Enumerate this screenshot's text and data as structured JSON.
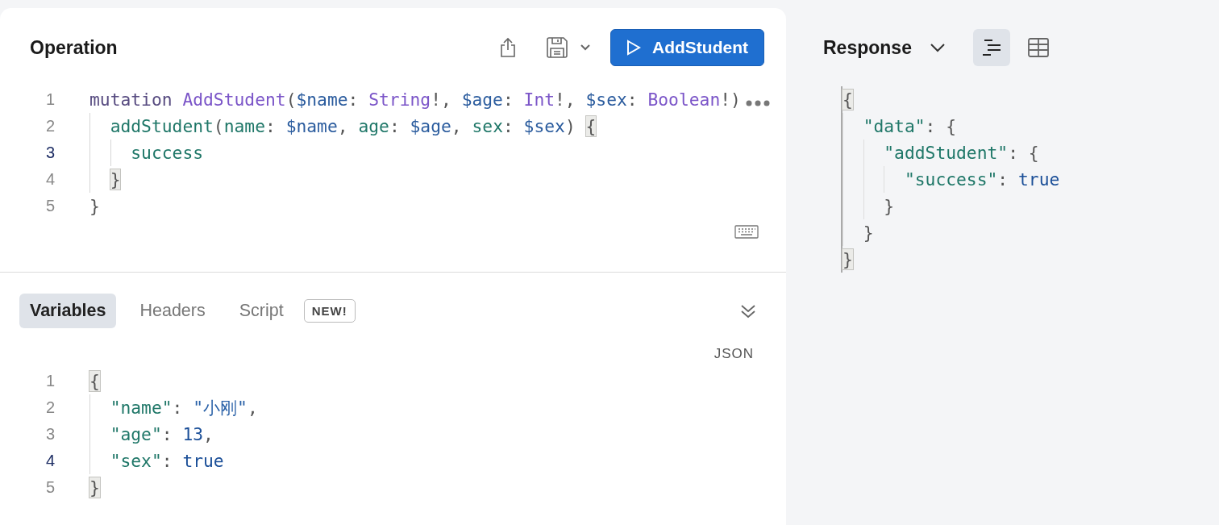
{
  "operation": {
    "title": "Operation",
    "run_button": "AddStudent",
    "lines": [
      {
        "number": "1",
        "current": false,
        "tokens": [
          {
            "kind": "keyword",
            "text": "mutation "
          },
          {
            "kind": "type",
            "text": "AddStudent"
          },
          {
            "kind": "punct",
            "text": "("
          },
          {
            "kind": "variable",
            "text": "$name"
          },
          {
            "kind": "punct",
            "text": ": "
          },
          {
            "kind": "type",
            "text": "String"
          },
          {
            "kind": "punct",
            "text": "!, "
          },
          {
            "kind": "variable",
            "text": "$age"
          },
          {
            "kind": "punct",
            "text": ": "
          },
          {
            "kind": "type",
            "text": "Int"
          },
          {
            "kind": "punct",
            "text": "!, "
          },
          {
            "kind": "variable",
            "text": "$sex"
          },
          {
            "kind": "punct",
            "text": ": "
          },
          {
            "kind": "type",
            "text": "Boolean"
          },
          {
            "kind": "punct",
            "text": "!)"
          }
        ]
      },
      {
        "number": "2",
        "current": false,
        "tokens": [
          {
            "kind": "field",
            "text": "  addStudent"
          },
          {
            "kind": "punct",
            "text": "("
          },
          {
            "kind": "field",
            "text": "name"
          },
          {
            "kind": "punct",
            "text": ": "
          },
          {
            "kind": "variable",
            "text": "$name"
          },
          {
            "kind": "punct",
            "text": ", "
          },
          {
            "kind": "field",
            "text": "age"
          },
          {
            "kind": "punct",
            "text": ": "
          },
          {
            "kind": "variable",
            "text": "$age"
          },
          {
            "kind": "punct",
            "text": ", "
          },
          {
            "kind": "field",
            "text": "sex"
          },
          {
            "kind": "punct",
            "text": ": "
          },
          {
            "kind": "variable",
            "text": "$sex"
          },
          {
            "kind": "punct",
            "text": ") "
          },
          {
            "kind": "match",
            "text": "{"
          }
        ]
      },
      {
        "number": "3",
        "current": true,
        "tokens": [
          {
            "kind": "field",
            "text": "    success"
          }
        ]
      },
      {
        "number": "4",
        "current": false,
        "tokens": [
          {
            "kind": "match",
            "text": "  }"
          }
        ]
      },
      {
        "number": "5",
        "current": false,
        "tokens": [
          {
            "kind": "punct",
            "text": "}"
          }
        ]
      }
    ]
  },
  "variables_panel": {
    "tabs": [
      {
        "label": "Variables",
        "selected": true
      },
      {
        "label": "Headers",
        "selected": false
      },
      {
        "label": "Script",
        "selected": false,
        "badge": "NEW!"
      }
    ],
    "format": "JSON",
    "lines": [
      {
        "number": "1",
        "current": false,
        "tokens": [
          {
            "kind": "match",
            "text": "{"
          }
        ]
      },
      {
        "number": "2",
        "current": false,
        "tokens": [
          {
            "kind": "key",
            "text": "  \"name\""
          },
          {
            "kind": "punct",
            "text": ": "
          },
          {
            "kind": "string",
            "text": "\"小刚\""
          },
          {
            "kind": "punct",
            "text": ","
          }
        ]
      },
      {
        "number": "3",
        "current": false,
        "tokens": [
          {
            "kind": "key",
            "text": "  \"age\""
          },
          {
            "kind": "punct",
            "text": ": "
          },
          {
            "kind": "number",
            "text": "13"
          },
          {
            "kind": "punct",
            "text": ","
          }
        ]
      },
      {
        "number": "4",
        "current": true,
        "tokens": [
          {
            "kind": "key",
            "text": "  \"sex\""
          },
          {
            "kind": "punct",
            "text": ": "
          },
          {
            "kind": "number",
            "text": "true"
          }
        ]
      },
      {
        "number": "5",
        "current": false,
        "tokens": [
          {
            "kind": "match",
            "text": "}"
          }
        ]
      }
    ]
  },
  "response": {
    "title": "Response",
    "views": [
      {
        "kind": "text",
        "selected": true
      },
      {
        "kind": "table",
        "selected": false
      }
    ],
    "lines": [
      {
        "tokens": [
          {
            "kind": "match",
            "text": "{"
          }
        ]
      },
      {
        "tokens": [
          {
            "kind": "key",
            "text": "  \"data\""
          },
          {
            "kind": "punct",
            "text": ": {"
          }
        ]
      },
      {
        "tokens": [
          {
            "kind": "key",
            "text": "    \"addStudent\""
          },
          {
            "kind": "punct",
            "text": ": {"
          }
        ]
      },
      {
        "tokens": [
          {
            "kind": "key",
            "text": "      \"success\""
          },
          {
            "kind": "punct",
            "text": ": "
          },
          {
            "kind": "number",
            "text": "true"
          }
        ]
      },
      {
        "tokens": [
          {
            "kind": "punct",
            "text": "    }"
          }
        ]
      },
      {
        "tokens": [
          {
            "kind": "punct",
            "text": "  }"
          }
        ]
      },
      {
        "tokens": [
          {
            "kind": "match",
            "text": "}"
          }
        ]
      }
    ]
  }
}
